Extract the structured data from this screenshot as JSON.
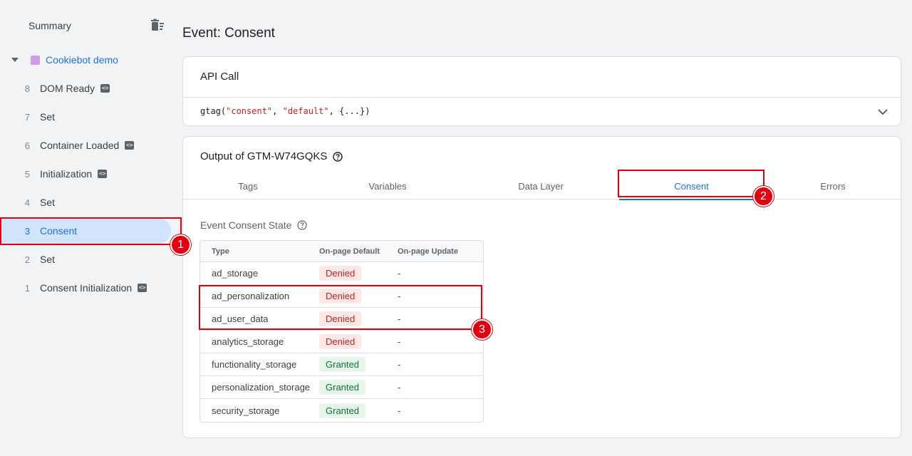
{
  "sidebar": {
    "summary_label": "Summary",
    "container": {
      "name": "Cookiebot demo",
      "color": "#d09ce8"
    },
    "events": [
      {
        "num": "8",
        "label": "DOM Ready",
        "badge": true,
        "active": false
      },
      {
        "num": "7",
        "label": "Set",
        "badge": false,
        "active": false
      },
      {
        "num": "6",
        "label": "Container Loaded",
        "badge": true,
        "active": false
      },
      {
        "num": "5",
        "label": "Initialization",
        "badge": true,
        "active": false
      },
      {
        "num": "4",
        "label": "Set",
        "badge": false,
        "active": false
      },
      {
        "num": "3",
        "label": "Consent",
        "badge": false,
        "active": true
      },
      {
        "num": "2",
        "label": "Set",
        "badge": false,
        "active": false
      },
      {
        "num": "1",
        "label": "Consent Initialization",
        "badge": true,
        "active": false
      }
    ]
  },
  "main": {
    "title": "Event: Consent",
    "api_call": {
      "title": "API Call",
      "code_prefix": "gtag(",
      "code_arg1": "\"consent\"",
      "code_sep": ", ",
      "code_arg2": "\"default\"",
      "code_suffix": ", {...})"
    },
    "output": {
      "title": "Output of GTM-W74GQKS",
      "tabs": [
        "Tags",
        "Variables",
        "Data Layer",
        "Consent",
        "Errors"
      ],
      "active_tab": "Consent",
      "section_title": "Event Consent State",
      "columns": [
        "Type",
        "On-page Default",
        "On-page Update"
      ],
      "rows": [
        {
          "type": "ad_storage",
          "default": "Denied",
          "update": "-"
        },
        {
          "type": "ad_personalization",
          "default": "Denied",
          "update": "-"
        },
        {
          "type": "ad_user_data",
          "default": "Denied",
          "update": "-"
        },
        {
          "type": "analytics_storage",
          "default": "Denied",
          "update": "-"
        },
        {
          "type": "functionality_storage",
          "default": "Granted",
          "update": "-"
        },
        {
          "type": "personalization_storage",
          "default": "Granted",
          "update": "-"
        },
        {
          "type": "security_storage",
          "default": "Granted",
          "update": "-"
        }
      ]
    }
  },
  "annotations": [
    "1",
    "2",
    "3"
  ],
  "colors": {
    "accent": "#1a73e8",
    "annotation": "#e0000f",
    "denied_bg": "#fce8e6",
    "granted_bg": "#e6f4ea"
  }
}
